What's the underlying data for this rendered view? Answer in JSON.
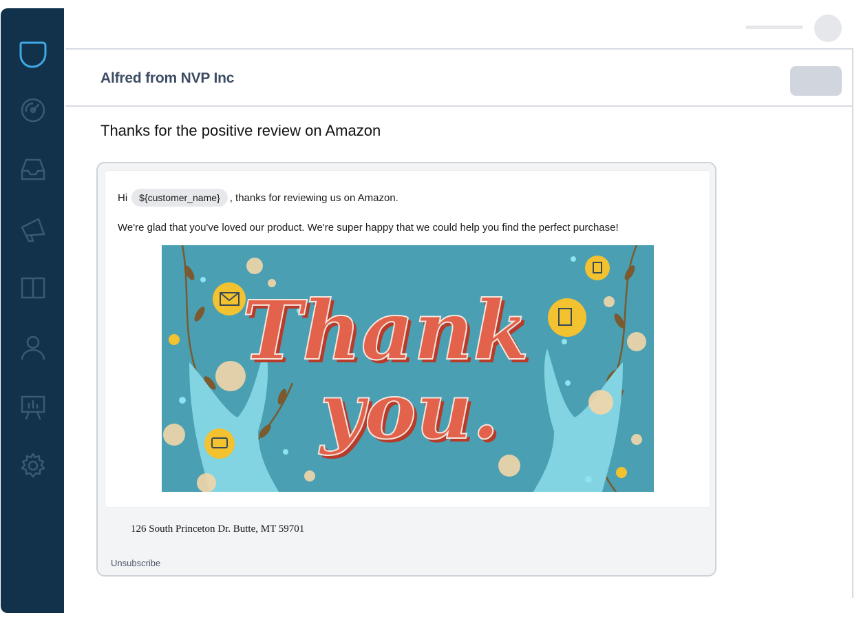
{
  "header": {
    "sender": "Alfred from NVP Inc"
  },
  "email": {
    "subject": "Thanks for the positive review on Amazon",
    "greeting_prefix": "Hi",
    "greeting_token": "${customer_name}",
    "greeting_suffix": ", thanks for reviewing us on Amazon.",
    "body_line": "We're glad that you've loved our product. We're super happy that we could help you find the perfect purchase!",
    "image": {
      "line1": "Thank",
      "line2": "you."
    },
    "footer_address": "126 South Princeton Dr. Butte, MT 59701",
    "unsubscribe": "Unsubscribe"
  },
  "sidebar": {
    "icons": [
      "logo-icon",
      "dashboard-gauge-icon",
      "inbox-tray-icon",
      "megaphone-icon",
      "book-icon",
      "user-icon",
      "presentation-chart-icon",
      "gear-icon"
    ]
  },
  "colors": {
    "sidebar_bg": "#12324b",
    "logo_accent": "#3fa9e6",
    "sidebar_icon": "#3a5a74",
    "image_bg": "#4a9fb3",
    "script_red": "#e2624b"
  }
}
